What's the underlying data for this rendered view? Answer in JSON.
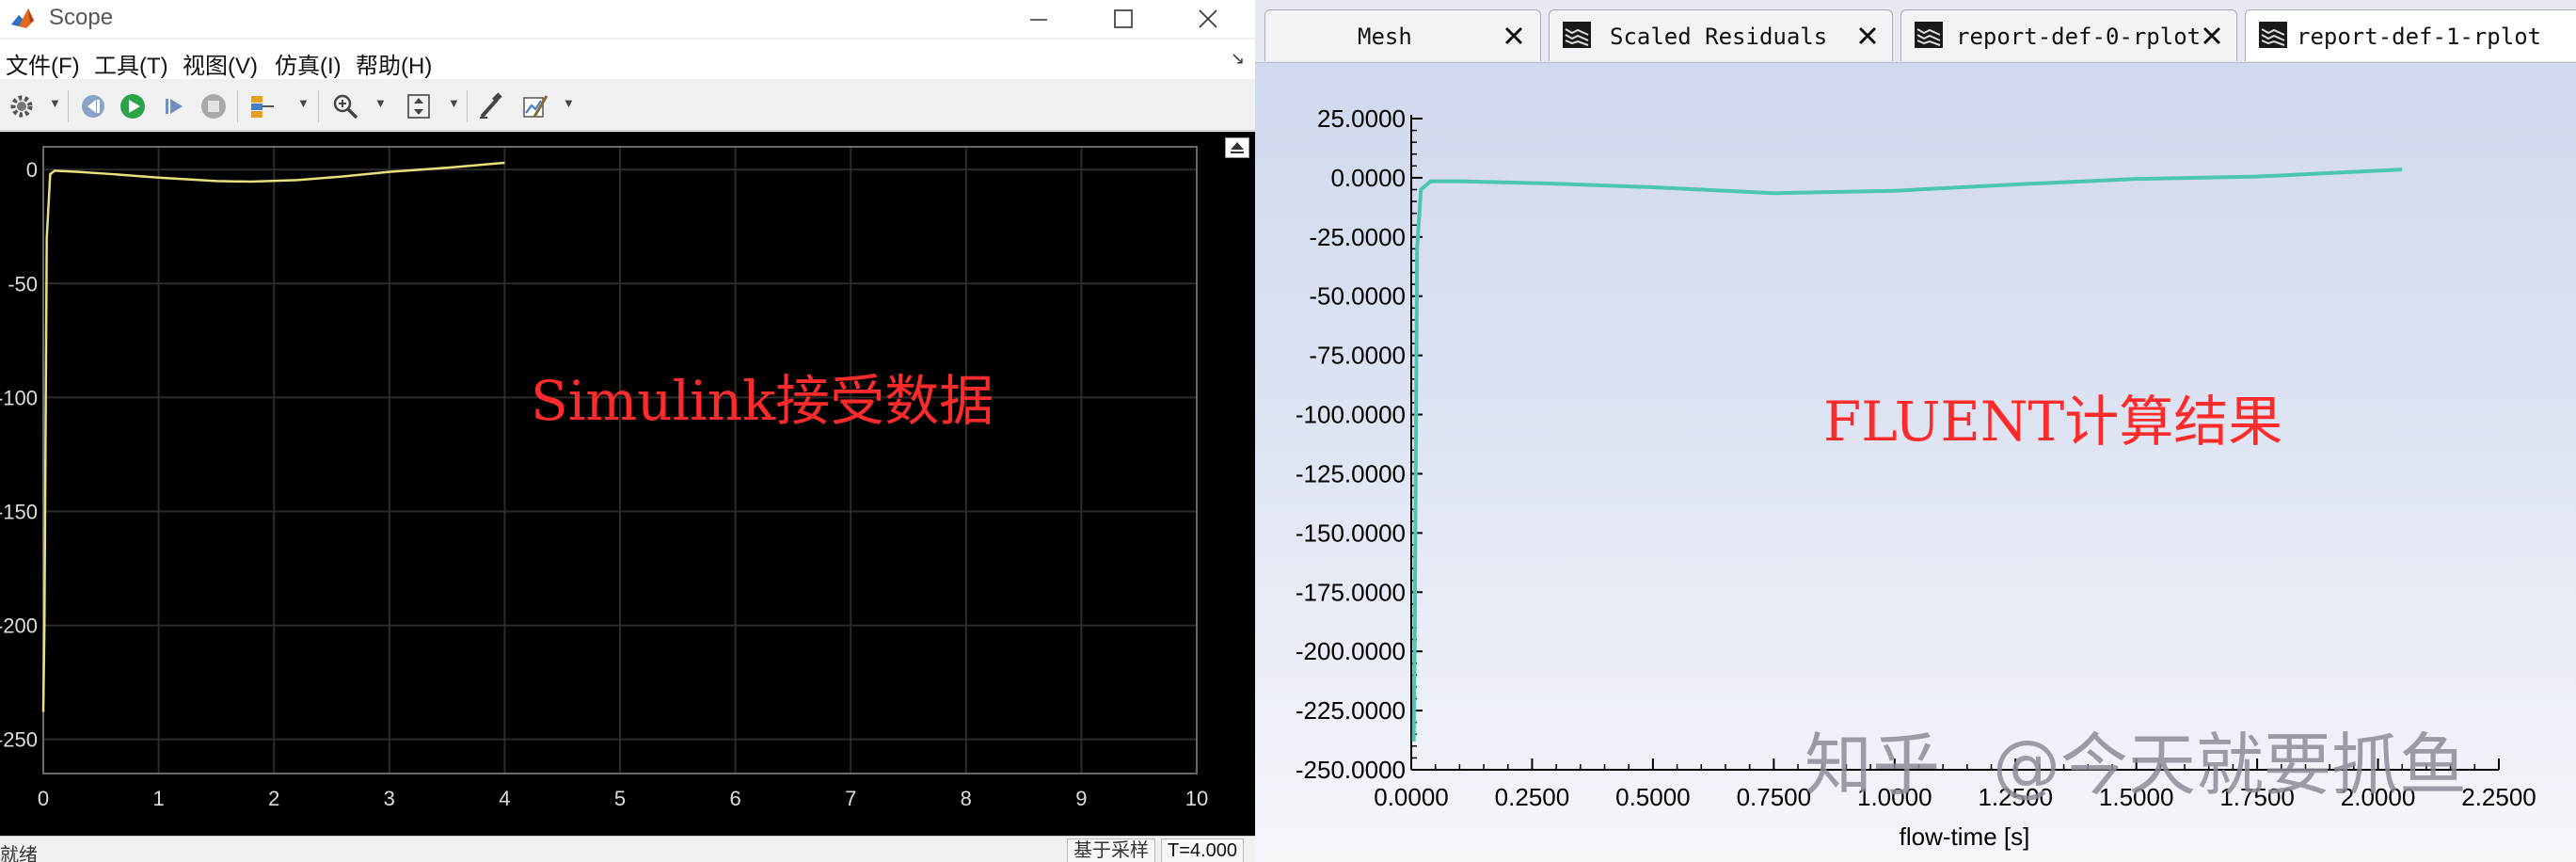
{
  "scope": {
    "title": "Scope",
    "menu": [
      "文件(F)",
      "工具(T)",
      "视图(V)",
      "仿真(I)",
      "帮助(H)"
    ],
    "toolbar_icons": [
      "settings-icon",
      "step-back-icon",
      "run-icon",
      "step-forward-icon",
      "stop-icon",
      "signal-icon",
      "zoom-icon",
      "scale-axes-icon",
      "highlight-icon",
      "measure-icon"
    ],
    "annotation": "Simulink接受数据",
    "status": {
      "ready": "就绪",
      "sample": "基于采样",
      "time": "T=4.000"
    },
    "colors": {
      "background": "#000000",
      "grid": "#2c2c2c",
      "line": "#e8e07a",
      "tick": "#dddddd"
    }
  },
  "fluent": {
    "tabs": [
      {
        "label": "Mesh",
        "active": false,
        "icon": ""
      },
      {
        "label": "Scaled Residuals",
        "active": false,
        "icon": "residual-plot-icon"
      },
      {
        "label": "report-def-0-rplot",
        "active": false,
        "icon": "report-plot-icon"
      },
      {
        "label": "report-def-1-rplot",
        "active": true,
        "icon": "report-plot-icon"
      }
    ],
    "annotation": "FLUENT计算结果",
    "colors": {
      "line": "#4cc6b1",
      "axis": "#000000"
    }
  },
  "watermark": {
    "logo": "知乎",
    "handle": "@今天就要抓鱼"
  },
  "chart_data": [
    {
      "type": "line",
      "title": "",
      "xlabel": "",
      "ylabel": "",
      "xlim": [
        0,
        10
      ],
      "ylim": [
        -265,
        10
      ],
      "xticks": [
        "0",
        "1",
        "2",
        "3",
        "4",
        "5",
        "6",
        "7",
        "8",
        "9",
        "10"
      ],
      "xtick_values": [
        0,
        1,
        2,
        3,
        4,
        5,
        6,
        7,
        8,
        9,
        10
      ],
      "yticks": [
        "0",
        "-50",
        "-100",
        "-150",
        "-200",
        "-250"
      ],
      "ytick_values": [
        0,
        -50,
        -100,
        -150,
        -200,
        -250
      ],
      "grid": true,
      "series": [
        {
          "x": [
            0,
            0.01,
            0.03,
            0.06,
            0.1,
            0.3,
            0.6,
            1.0,
            1.5,
            1.8,
            2.2,
            2.6,
            3.0,
            3.5,
            4.0
          ],
          "y": [
            -238,
            -200,
            -30,
            -2,
            -0.5,
            -1.0,
            -2.0,
            -3.5,
            -5.0,
            -5.3,
            -4.6,
            -3.0,
            -1.0,
            0.8,
            3.0
          ]
        }
      ]
    },
    {
      "type": "line",
      "title": "",
      "xlabel": "flow-time [s]",
      "ylabel": "",
      "xlim": [
        0,
        2.25
      ],
      "ylim": [
        -250,
        25
      ],
      "xticks": [
        "0.0000",
        "0.2500",
        "0.5000",
        "0.7500",
        "1.0000",
        "1.2500",
        "1.5000",
        "1.7500",
        "2.0000",
        "2.2500"
      ],
      "xtick_values": [
        0,
        0.25,
        0.5,
        0.75,
        1.0,
        1.25,
        1.5,
        1.75,
        2.0,
        2.25
      ],
      "yticks": [
        "25.0000",
        "0.0000",
        "-25.0000",
        "-50.0000",
        "-75.0000",
        "-100.0000",
        "-125.0000",
        "-150.0000",
        "-175.0000",
        "-200.0000",
        "-225.0000",
        "-250.0000"
      ],
      "ytick_values": [
        25,
        0,
        -25,
        -50,
        -75,
        -100,
        -125,
        -150,
        -175,
        -200,
        -225,
        -250
      ],
      "grid": false,
      "series": [
        {
          "x": [
            0.005,
            0.007,
            0.012,
            0.02,
            0.04,
            0.1,
            0.3,
            0.5,
            0.75,
            1.0,
            1.25,
            1.5,
            1.75,
            2.0,
            2.05
          ],
          "y": [
            -238,
            -200,
            -30,
            -5,
            -1.5,
            -1.5,
            -2.5,
            -4.0,
            -6.5,
            -5.5,
            -2.8,
            -0.5,
            0.5,
            3.0,
            3.5
          ]
        }
      ]
    }
  ]
}
